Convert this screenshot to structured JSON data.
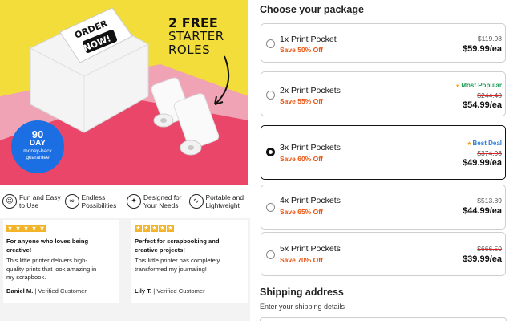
{
  "hero": {
    "image_alt": "Order now printer with paper rolls",
    "printer_text_1": "ORDER",
    "printer_text_2": "NOW!",
    "headline_1": "2 FREE",
    "headline_2": "STARTER",
    "headline_3": "ROLES",
    "guarantee_days": "90",
    "guarantee_unit": "DAY",
    "guarantee_line_1": "money-back",
    "guarantee_line_2": "guarantee"
  },
  "features": [
    {
      "icon": "user-heart-icon",
      "glyph": "☺",
      "label_1": "Fun and Easy",
      "label_2": "to Use"
    },
    {
      "icon": "infinity-icon",
      "glyph": "∞",
      "label_1": "Endless",
      "label_2": "Possibilities"
    },
    {
      "icon": "sparkle-hand-icon",
      "glyph": "✦",
      "label_1": "Designed for",
      "label_2": "Your Needs"
    },
    {
      "icon": "link-icon",
      "glyph": "∿",
      "label_1": "Portable and",
      "label_2": "Lightweight"
    }
  ],
  "reviews": [
    {
      "rating": 5,
      "title_1": "For anyone who loves being",
      "title_2": "creative!",
      "body_1": "This little printer delivers high-",
      "body_2": "quality prints that look amazing in",
      "body_3": "my scrapbook.",
      "author": "Daniel M.",
      "verified": "| Verified Customer"
    },
    {
      "rating": 5,
      "title_1": "Perfect for scrapbooking and",
      "title_2": "creative projects!",
      "body_1": "This little printer has completely",
      "body_2": "transformed my journaling!",
      "body_3": "",
      "author": "Lily T.",
      "verified": "| Verified Customer"
    }
  ],
  "package": {
    "heading": "Choose your package",
    "options": [
      {
        "name": "1x Print Pocket",
        "save": "Save 50% Off",
        "badge": "",
        "badge_color": "",
        "original": "$119.98",
        "price": "$59.99/ea",
        "selected": false
      },
      {
        "name": "2x Print Pockets",
        "save": "Save 55% Off",
        "badge": "Most Popular",
        "badge_color": "#1f9d57",
        "original": "$244.40",
        "price": "$54.99/ea",
        "selected": false
      },
      {
        "name": "3x Print Pockets",
        "save": "Save 60% Off",
        "badge": "Best Deal",
        "badge_color": "#2a7fd6",
        "original": "$374.93",
        "price": "$49.99/ea",
        "selected": true
      },
      {
        "name": "4x Print Pockets",
        "save": "Save 65% Off",
        "badge": "",
        "badge_color": "",
        "original": "$513.89",
        "price": "$44.99/ea",
        "selected": false
      },
      {
        "name": "5x Print Pockets",
        "save": "Save 70% Off",
        "badge": "",
        "badge_color": "",
        "original": "$666.50",
        "price": "$39.99/ea",
        "selected": false
      }
    ]
  },
  "shipping": {
    "heading": "Shipping address",
    "subheading": "Enter your shipping details"
  },
  "colors": {
    "accent_orange": "#e8520e",
    "guarantee_blue": "#1b6fe3",
    "star_gold": "#f3b429"
  }
}
